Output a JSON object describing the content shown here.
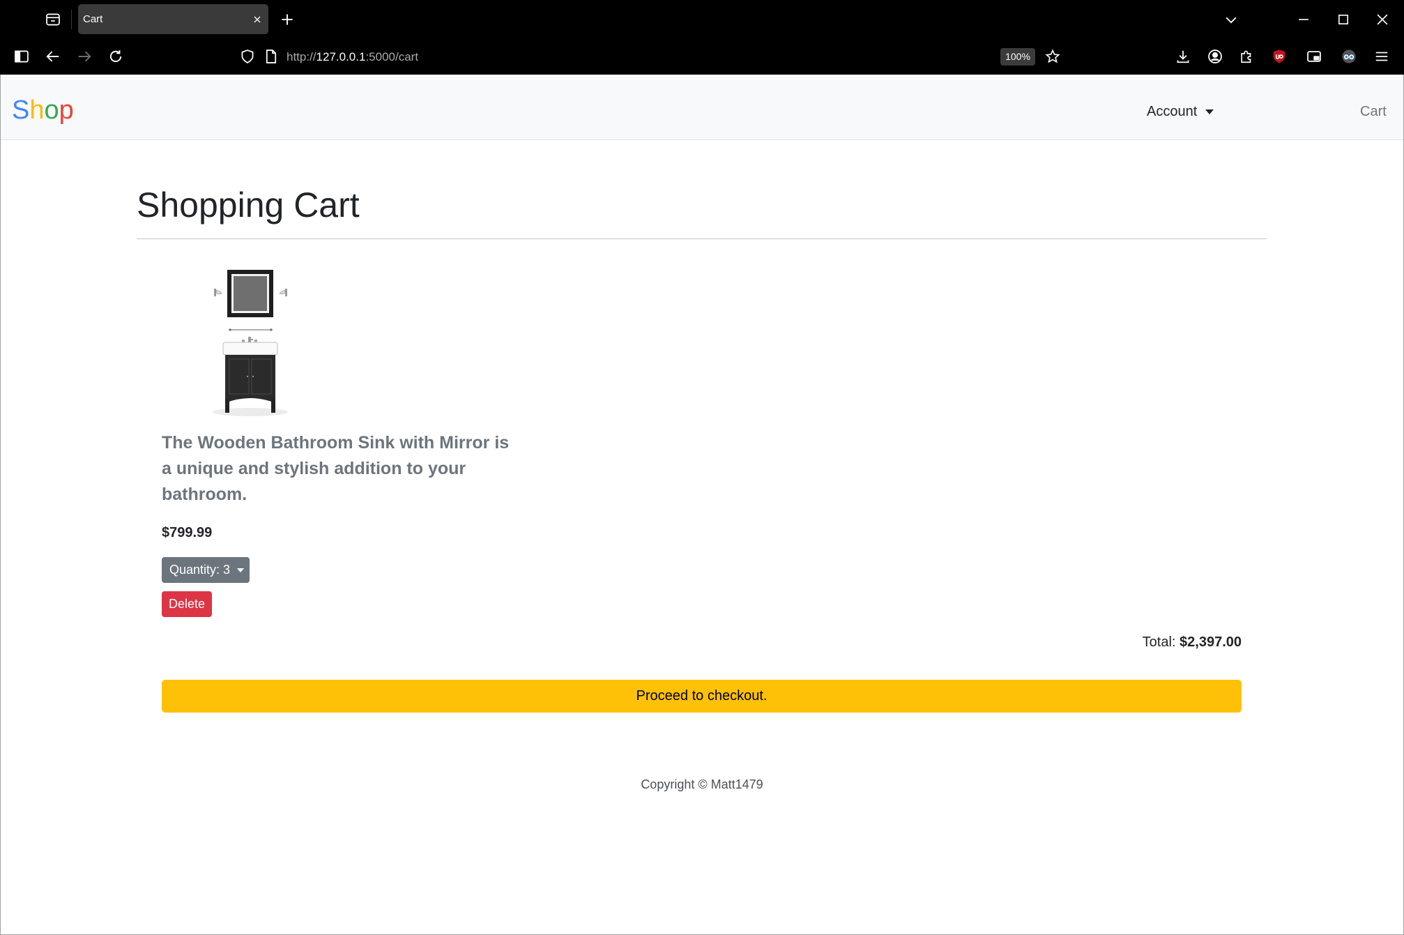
{
  "browser": {
    "tab_title": "Cart",
    "url": {
      "scheme": "http://",
      "host": "127.0.0.1",
      "path": ":5000/cart"
    },
    "zoom_label": "100%",
    "icons": {
      "tab_bar": [
        "tab-list-icon",
        "close-icon",
        "plus-icon",
        "chevron-down-icon",
        "minimize-icon",
        "maximize-icon",
        "window-close-icon"
      ],
      "toolbar": [
        "sidebar-icon",
        "back-arrow-icon",
        "forward-arrow-icon",
        "reload-icon",
        "shield-icon",
        "page-icon",
        "star-icon",
        "download-icon",
        "account-icon",
        "extensions-icon",
        "ublock-icon",
        "picture-in-picture-icon",
        "extension-icon",
        "menu-icon"
      ]
    }
  },
  "navbar": {
    "brand": [
      {
        "char": "S",
        "color": "#4285F4"
      },
      {
        "char": "h",
        "color": "#FBBC05"
      },
      {
        "char": "o",
        "color": "#34A853"
      },
      {
        "char": "p",
        "color": "#EA4335"
      }
    ],
    "account_label": "Account",
    "cart_label": "Cart"
  },
  "main": {
    "heading": "Shopping Cart",
    "items": [
      {
        "description": "The Wooden Bathroom Sink with Mirror is a unique and stylish addition to your bathroom.",
        "price": "$799.99",
        "quantity_label": "Quantity: 3",
        "delete_label": "Delete"
      }
    ],
    "total_label": "Total:",
    "total_value": "$2,397.00",
    "checkout_label": "Proceed to checkout."
  },
  "footer": {
    "copyright": "Copyright © Matt1479"
  },
  "colors": {
    "chrome_bg": "#000000",
    "tab_active_bg": "#3a3a3a",
    "navbar_bg": "#f8f9fa",
    "text_muted": "#6c757d",
    "secondary_button": "#6c757d",
    "danger_button": "#dc3545",
    "warning_button": "#ffc107"
  }
}
